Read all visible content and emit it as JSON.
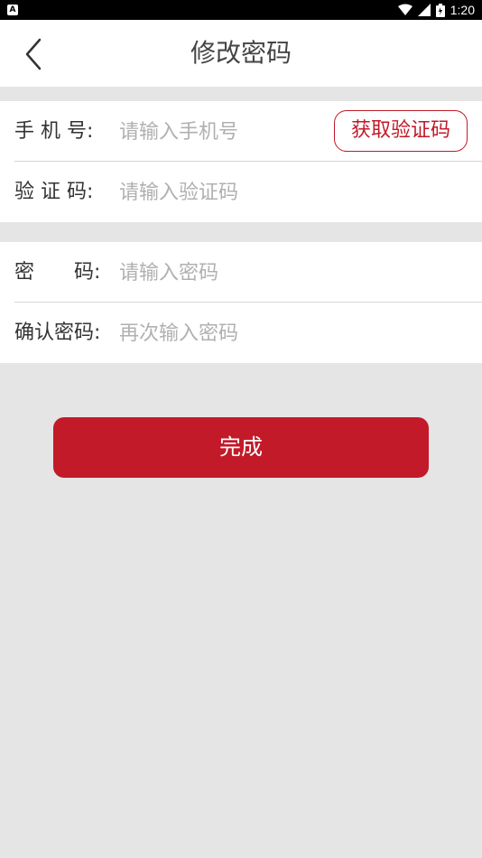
{
  "status_bar": {
    "time": "1:20",
    "icons": [
      "notification-a-icon",
      "wifi-icon",
      "signal-icon",
      "battery-icon"
    ]
  },
  "header": {
    "title": "修改密码",
    "back_icon": "chevron-left-icon"
  },
  "form": {
    "phone": {
      "label": "手 机 号:",
      "placeholder": "请输入手机号",
      "value": ""
    },
    "get_code_button": "获取验证码",
    "code": {
      "label": "验 证 码:",
      "placeholder": "请输入验证码",
      "value": ""
    },
    "password": {
      "label": "密　　码:",
      "placeholder": "请输入密码",
      "value": ""
    },
    "confirm_password": {
      "label": "确认密码:",
      "placeholder": "再次输入密码",
      "value": ""
    }
  },
  "submit_button": "完成",
  "colors": {
    "accent": "#c21a28",
    "background": "#e5e5e5",
    "card": "#ffffff",
    "placeholder": "#b0b0b0"
  }
}
